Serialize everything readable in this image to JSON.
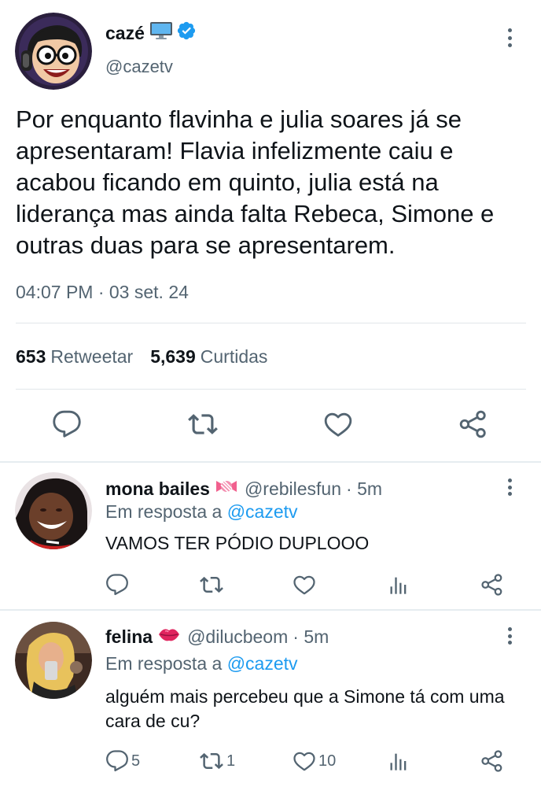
{
  "main_tweet": {
    "name": "cazé",
    "name_emoji": "computer-emoji",
    "verified": true,
    "handle": "@cazetv",
    "text": "Por enquanto flavinha e julia soares já se apresentaram! Flavia infelizmente caiu e acabou ficando em quinto, julia está na liderança mas ainda falta Rebeca, Simone e outras duas para se apresentarem.",
    "timestamp": "04:07 PM · 03 set. 24",
    "retweet_count": "653",
    "retweet_label": "Retweetar",
    "like_count": "5,639",
    "like_label": "Curtidas"
  },
  "replies": [
    {
      "name": "mona bailes",
      "name_emoji": "candy-emoji",
      "handle": "@rebilesfun",
      "time": "· 5m",
      "reply_prefix": "Em resposta a",
      "reply_to": "@cazetv",
      "text": "VAMOS TER PÓDIO DUPLOOO",
      "reply_count": "",
      "retweet_count": "",
      "like_count": ""
    },
    {
      "name": "felina",
      "name_emoji": "lips-emoji",
      "handle": "@dilucbeom",
      "time": "· 5m",
      "reply_prefix": "Em resposta a",
      "reply_to": "@cazetv",
      "text": "alguém mais percebeu que a Simone tá com uma cara de cu?",
      "reply_count": "5",
      "retweet_count": "1",
      "like_count": "10"
    }
  ],
  "icons": [
    "more-icon",
    "reply-icon",
    "retweet-icon",
    "like-icon",
    "share-icon",
    "views-icon",
    "verified-icon"
  ],
  "colors": {
    "verified": "#1d9bf0",
    "mention": "#1d9bf0",
    "secondary_text": "#536471",
    "primary_text": "#0f1419"
  }
}
